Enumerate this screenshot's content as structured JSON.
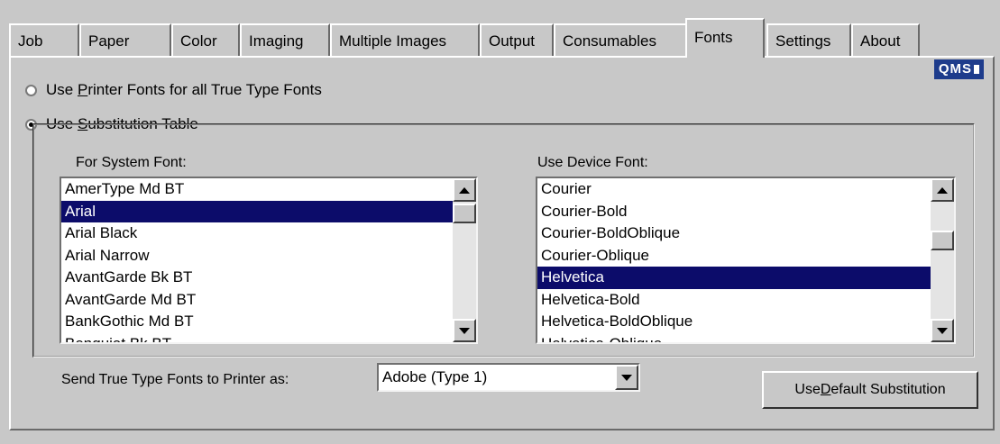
{
  "tabs": [
    "Job",
    "Paper",
    "Color",
    "Imaging",
    "Multiple Images",
    "Output",
    "Consumables",
    "Fonts",
    "Settings",
    "About"
  ],
  "active_tab": "Fonts",
  "logo_text": "QMS",
  "radio_printer_fonts": {
    "prefix": "Use ",
    "mnemonic": "P",
    "rest": "rinter Fonts for all True Type Fonts",
    "checked": false
  },
  "radio_substitution": {
    "prefix": "Use ",
    "mnemonic": "S",
    "rest": "ubstitution Table",
    "checked": true
  },
  "system_font": {
    "label": "For System Font:",
    "items": [
      "AmerType Md BT",
      "Arial",
      "Arial Black",
      "Arial Narrow",
      "AvantGarde Bk BT",
      "AvantGarde Md BT",
      "BankGothic Md BT",
      "Benguiat Bk BT"
    ],
    "selected": "Arial"
  },
  "device_font": {
    "label": "Use Device Font:",
    "items": [
      "Courier",
      "Courier-Bold",
      "Courier-BoldOblique",
      "Courier-Oblique",
      "Helvetica",
      "Helvetica-Bold",
      "Helvetica-BoldOblique",
      "Helvetica-Oblique"
    ],
    "selected": "Helvetica"
  },
  "send_label": "Send True Type Fonts to Printer as:",
  "send_value": "Adobe (Type 1)",
  "default_button": {
    "prefix": "Use ",
    "mnemonic": "D",
    "rest": "efault Substitution"
  }
}
